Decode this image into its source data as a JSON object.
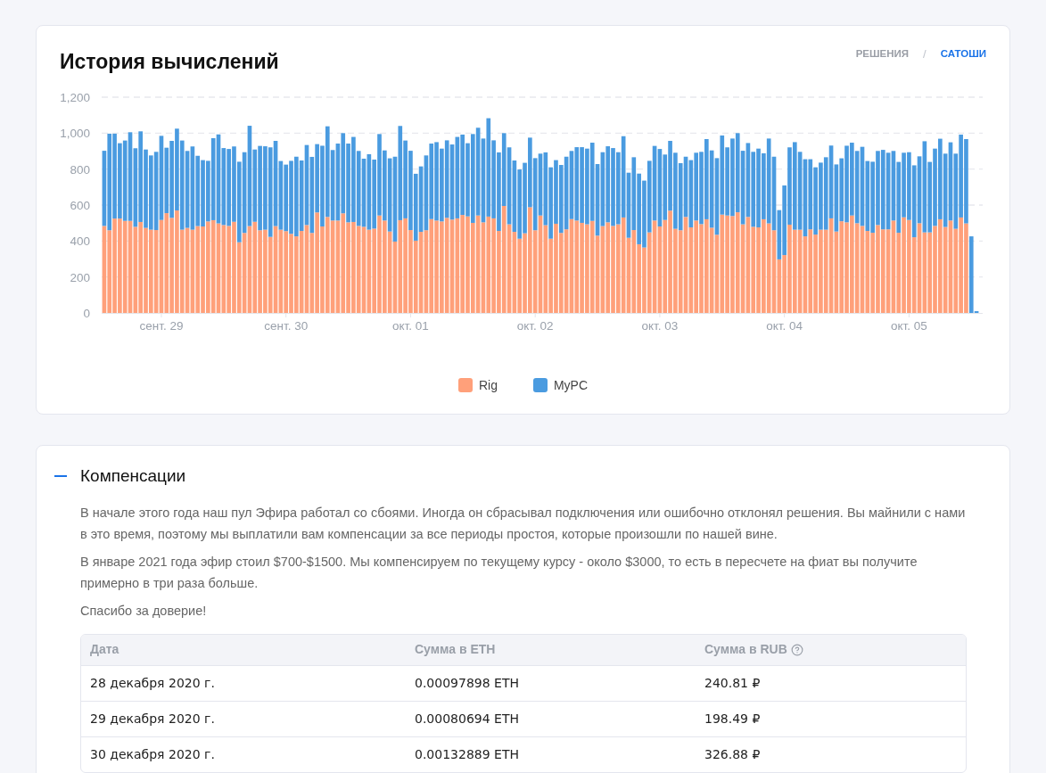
{
  "history": {
    "title": "История вычислений",
    "unit_toggle": {
      "separator": "/",
      "options": [
        {
          "label": "РЕШЕНИЯ",
          "selected": false
        },
        {
          "label": "САТОШИ",
          "selected": true
        }
      ]
    },
    "chart_data": {
      "type": "bar",
      "stacked": true,
      "grid": true,
      "ylim": [
        0,
        1200
      ],
      "yticks": [
        0,
        200,
        400,
        600,
        800,
        {
          "value": 1000,
          "label": "1,000"
        },
        {
          "value": 1200,
          "label": "1,200"
        }
      ],
      "categories": [
        null,
        null,
        null,
        null,
        null,
        null,
        null,
        null,
        null,
        null,
        null,
        "сент. 29",
        null,
        null,
        null,
        null,
        null,
        null,
        null,
        null,
        null,
        null,
        null,
        null,
        null,
        null,
        null,
        null,
        null,
        null,
        null,
        null,
        null,
        null,
        null,
        "сент. 30",
        null,
        null,
        null,
        null,
        null,
        null,
        null,
        null,
        null,
        null,
        null,
        null,
        null,
        null,
        null,
        null,
        null,
        null,
        null,
        null,
        null,
        null,
        null,
        "окт. 01",
        null,
        null,
        null,
        null,
        null,
        null,
        null,
        null,
        null,
        null,
        null,
        null,
        null,
        null,
        null,
        null,
        null,
        null,
        null,
        null,
        null,
        null,
        null,
        "окт. 02",
        null,
        null,
        null,
        null,
        null,
        null,
        null,
        null,
        null,
        null,
        null,
        null,
        null,
        null,
        null,
        null,
        null,
        null,
        null,
        null,
        null,
        null,
        null,
        "окт. 03",
        null,
        null,
        null,
        null,
        null,
        null,
        null,
        null,
        null,
        null,
        null,
        null,
        null,
        null,
        null,
        null,
        null,
        null,
        null,
        null,
        null,
        null,
        null,
        "окт. 04",
        null,
        null,
        null,
        null,
        null,
        null,
        null,
        null,
        null,
        null,
        null,
        null,
        null,
        null,
        null,
        null,
        null,
        null,
        null,
        null,
        null,
        null,
        null,
        "окт. 05",
        null,
        null,
        null,
        null,
        null,
        null,
        null,
        null,
        null,
        null,
        null,
        null,
        null
      ],
      "series": [
        {
          "name": "Rig",
          "color": "#ffa07a",
          "values": [
            484,
            460,
            525,
            525,
            512,
            512,
            479,
            506,
            473,
            463,
            461,
            517,
            555,
            529,
            570,
            463,
            473,
            463,
            483,
            481,
            509,
            516,
            498,
            489,
            484,
            507,
            393,
            445,
            483,
            507,
            460,
            463,
            423,
            483,
            463,
            455,
            440,
            426,
            456,
            489,
            445,
            559,
            481,
            534,
            514,
            514,
            554,
            504,
            506,
            484,
            479,
            463,
            469,
            542,
            514,
            453,
            397,
            516,
            526,
            461,
            402,
            451,
            460,
            522,
            514,
            509,
            529,
            519,
            526,
            545,
            537,
            501,
            542,
            504,
            536,
            526,
            456,
            595,
            493,
            451,
            413,
            443,
            588,
            460,
            542,
            488,
            413,
            496,
            445,
            465,
            522,
            514,
            501,
            493,
            512,
            430,
            483,
            504,
            484,
            493,
            531,
            418,
            461,
            382,
            364,
            448,
            514,
            481,
            517,
            569,
            468,
            460,
            534,
            476,
            514,
            494,
            521,
            474,
            435,
            547,
            542,
            539,
            560,
            493,
            534,
            479,
            476,
            521,
            498,
            460,
            298,
            322,
            491,
            463,
            463,
            426,
            465,
            436,
            463,
            463,
            526,
            453,
            510,
            504,
            542,
            499,
            484,
            456,
            446,
            489,
            465,
            465,
            514,
            446,
            532,
            517,
            421,
            499,
            448,
            448,
            484,
            521,
            478,
            514,
            468,
            531,
            498,
            0,
            0
          ]
        },
        {
          "name": "MyPC",
          "color": "#4a9be0",
          "values": [
            418,
            537,
            472,
            419,
            447,
            493,
            437,
            504,
            436,
            413,
            435,
            468,
            364,
            428,
            455,
            496,
            428,
            463,
            391,
            369,
            337,
            456,
            495,
            428,
            428,
            419,
            448,
            449,
            558,
            402,
            469,
            464,
            498,
            474,
            382,
            370,
            406,
            443,
            392,
            445,
            423,
            380,
            449,
            504,
            392,
            428,
            446,
            438,
            473,
            417,
            379,
            420,
            384,
            453,
            390,
            407,
            472,
            524,
            433,
            441,
            372,
            364,
            416,
            420,
            436,
            405,
            431,
            418,
            453,
            447,
            407,
            494,
            488,
            466,
            547,
            434,
            437,
            405,
            428,
            397,
            385,
            392,
            387,
            401,
            344,
            405,
            397,
            354,
            378,
            404,
            379,
            408,
            421,
            421,
            435,
            398,
            411,
            423,
            433,
            401,
            452,
            362,
            405,
            393,
            372,
            398,
            415,
            431,
            364,
            388,
            423,
            373,
            335,
            374,
            377,
            402,
            446,
            430,
            426,
            440,
            379,
            431,
            440,
            409,
            411,
            417,
            438,
            367,
            472,
            409,
            274,
            387,
            430,
            487,
            433,
            429,
            390,
            374,
            373,
            403,
            405,
            373,
            350,
            426,
            405,
            402,
            440,
            389,
            395,
            412,
            442,
            426,
            387,
            394,
            359,
            377,
            400,
            372,
            507,
            392,
            430,
            448,
            408,
            435,
            418,
            461,
            469,
            426,
            10
          ]
        }
      ]
    }
  },
  "compensation": {
    "title": "Компенсации",
    "expanded": true,
    "paragraphs": [
      "В начале этого года наш пул Эфира работал со сбоями. Иногда он сбрасывал подключения или ошибочно отклонял решения. Вы майнили с нами в это время, поэтому мы выплатили вам компенсации за все периоды простоя, которые произошли по нашей вине.",
      "В январе 2021 года эфир стоил $700-$1500. Мы компенсируем по текущему курсу - около $3000, то есть в пересчете на фиат вы получите примерно в три раза больше.",
      "Спасибо за доверие!"
    ],
    "table": {
      "columns": [
        "Дата",
        "Сумма в ETH",
        "Сумма в RUB"
      ],
      "rows": [
        [
          "28 декабря 2020 г.",
          "0.00097898 ETH",
          "240.81 ₽"
        ],
        [
          "29 декабря 2020 г.",
          "0.00080694 ETH",
          "198.49 ₽"
        ],
        [
          "30 декабря 2020 г.",
          "0.00132889 ETH",
          "326.88 ₽"
        ]
      ]
    }
  }
}
